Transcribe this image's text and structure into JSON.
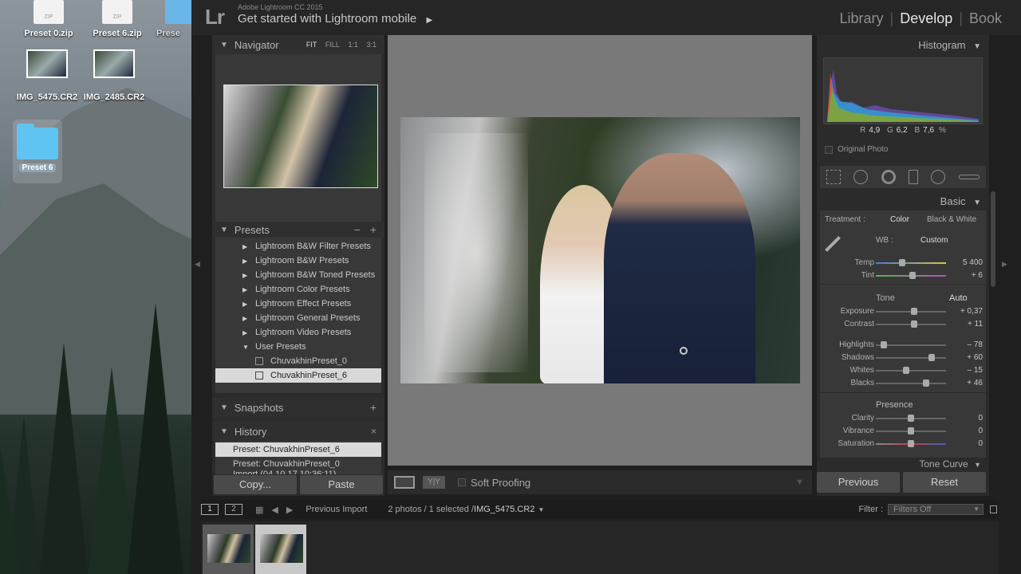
{
  "desktop": {
    "icons": [
      {
        "label": "Preset 0.zip",
        "badge": "ZIP"
      },
      {
        "label": "Preset 6.zip",
        "badge": "ZIP"
      },
      {
        "label": "Prese",
        "badge": ""
      },
      {
        "label": "IMG_5475.CR2"
      },
      {
        "label": "IMG_2485.CR2"
      },
      {
        "label": "Preset 6"
      }
    ]
  },
  "app": {
    "logo": "Lr",
    "subtitle": "Adobe Lightroom CC 2015",
    "banner": "Get started with Lightroom mobile",
    "banner_arrow": "▶",
    "modules": [
      "Library",
      "Develop",
      "Book"
    ],
    "active_module": "Develop"
  },
  "navigator": {
    "title": "Navigator",
    "zoom": [
      "FIT",
      "FILL",
      "1:1",
      "3:1"
    ]
  },
  "presets": {
    "title": "Presets",
    "items": [
      "Lightroom B&W Filter Presets",
      "Lightroom B&W Presets",
      "Lightroom B&W Toned Presets",
      "Lightroom Color Presets",
      "Lightroom Effect Presets",
      "Lightroom General Presets",
      "Lightroom Video Presets",
      "User Presets"
    ],
    "user": [
      "ChuvakhinPreset_0",
      "ChuvakhinPreset_6"
    ]
  },
  "snapshots": {
    "title": "Snapshots"
  },
  "history": {
    "title": "History",
    "items": [
      "Preset: ChuvakhinPreset_6",
      "Preset: ChuvakhinPreset_0",
      "Import (04.10.17 10:36:11)"
    ]
  },
  "left_buttons": {
    "copy": "Copy...",
    "paste": "Paste"
  },
  "toolbar": {
    "soft_proofing": "Soft Proofing",
    "yy": "Y|Y"
  },
  "right": {
    "histogram_title": "Histogram",
    "rgb": {
      "r_label": "R",
      "r": "4,9",
      "g_label": "G",
      "g": "6,2",
      "b_label": "B",
      "b": "7,6",
      "unit": "%"
    },
    "original_photo": "Original Photo",
    "basic_title": "Basic",
    "treatment_label": "Treatment :",
    "treatment_color": "Color",
    "treatment_bw": "Black & White",
    "wb_label": "WB :",
    "wb_value": "Custom",
    "tone_label": "Tone",
    "auto_label": "Auto",
    "presence_label": "Presence",
    "tone_curve": "Tone Curve",
    "sliders": [
      {
        "label": "Temp",
        "value": "5 400",
        "pos": 0.37
      },
      {
        "label": "Tint",
        "value": "+ 6",
        "pos": 0.52
      },
      {
        "label": "Exposure",
        "value": "+ 0,37",
        "pos": 0.54
      },
      {
        "label": "Contrast",
        "value": "+ 11",
        "pos": 0.55
      },
      {
        "label": "Highlights",
        "value": "– 78",
        "pos": 0.11
      },
      {
        "label": "Shadows",
        "value": "+ 60",
        "pos": 0.8
      },
      {
        "label": "Whites",
        "value": "– 15",
        "pos": 0.43
      },
      {
        "label": "Blacks",
        "value": "+ 46",
        "pos": 0.72
      },
      {
        "label": "Clarity",
        "value": "0",
        "pos": 0.5
      },
      {
        "label": "Vibrance",
        "value": "0",
        "pos": 0.5
      },
      {
        "label": "Saturation",
        "value": "0",
        "pos": 0.5
      }
    ],
    "previous": "Previous",
    "reset": "Reset"
  },
  "filmstrip": {
    "pages": [
      "1",
      "2"
    ],
    "source": "Previous Import",
    "count": "2 photos / 1 selected /",
    "file": "IMG_5475.CR2",
    "filter_label": "Filter :",
    "filter_value": "Filters Off"
  }
}
